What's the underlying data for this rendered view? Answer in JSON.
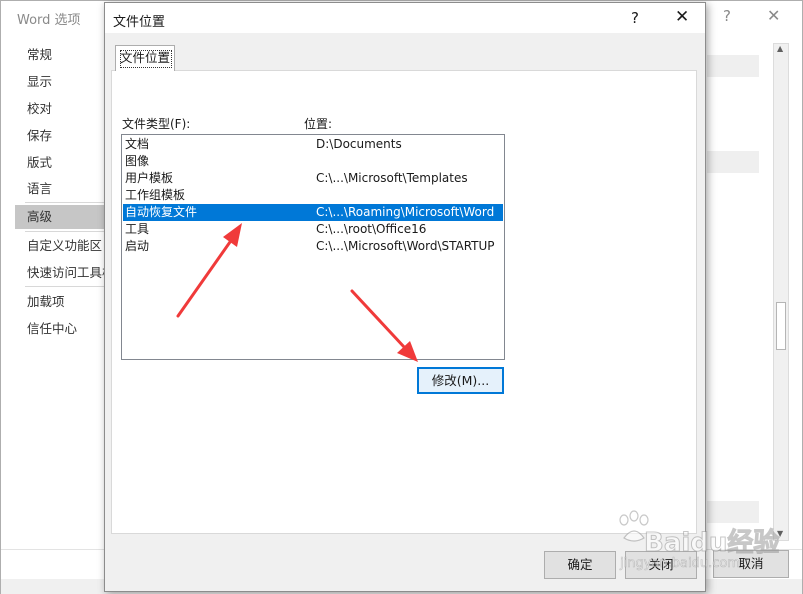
{
  "background_window": {
    "title": "Word 选项",
    "help": "?",
    "close": "✕",
    "nav_items": [
      {
        "label": "常规"
      },
      {
        "label": "显示"
      },
      {
        "label": "校对"
      },
      {
        "label": "保存"
      },
      {
        "label": "版式"
      },
      {
        "label": "语言"
      },
      {
        "label": "高级"
      },
      {
        "label": "自定义功能区"
      },
      {
        "label": "快速访问工具栏"
      },
      {
        "label": "加载项"
      },
      {
        "label": "信任中心"
      }
    ],
    "cancel_label": "取消"
  },
  "dialog": {
    "title": "文件位置",
    "help": "?",
    "close": "✕",
    "tab_label": "文件位置",
    "file_types_label": "文件类型(F):",
    "location_label": "位置:",
    "rows": [
      {
        "type": "文档",
        "location": "D:\\Documents"
      },
      {
        "type": "图像",
        "location": ""
      },
      {
        "type": "用户模板",
        "location": "C:\\...\\Microsoft\\Templates"
      },
      {
        "type": "工作组模板",
        "location": ""
      },
      {
        "type": "自动恢复文件",
        "location": "C:\\...\\Roaming\\Microsoft\\Word",
        "selected": true
      },
      {
        "type": "工具",
        "location": "C:\\...\\root\\Office16"
      },
      {
        "type": "启动",
        "location": "C:\\...\\Microsoft\\Word\\STARTUP"
      }
    ],
    "modify_label": "修改(M)...",
    "ok_label": "确定",
    "close_label": "关闭"
  },
  "watermark": {
    "brand": "Baidu经验",
    "url": "jingyan.baidu.com"
  },
  "colors": {
    "selection": "#0078d7",
    "annotation_arrow": "#f03a3a"
  }
}
